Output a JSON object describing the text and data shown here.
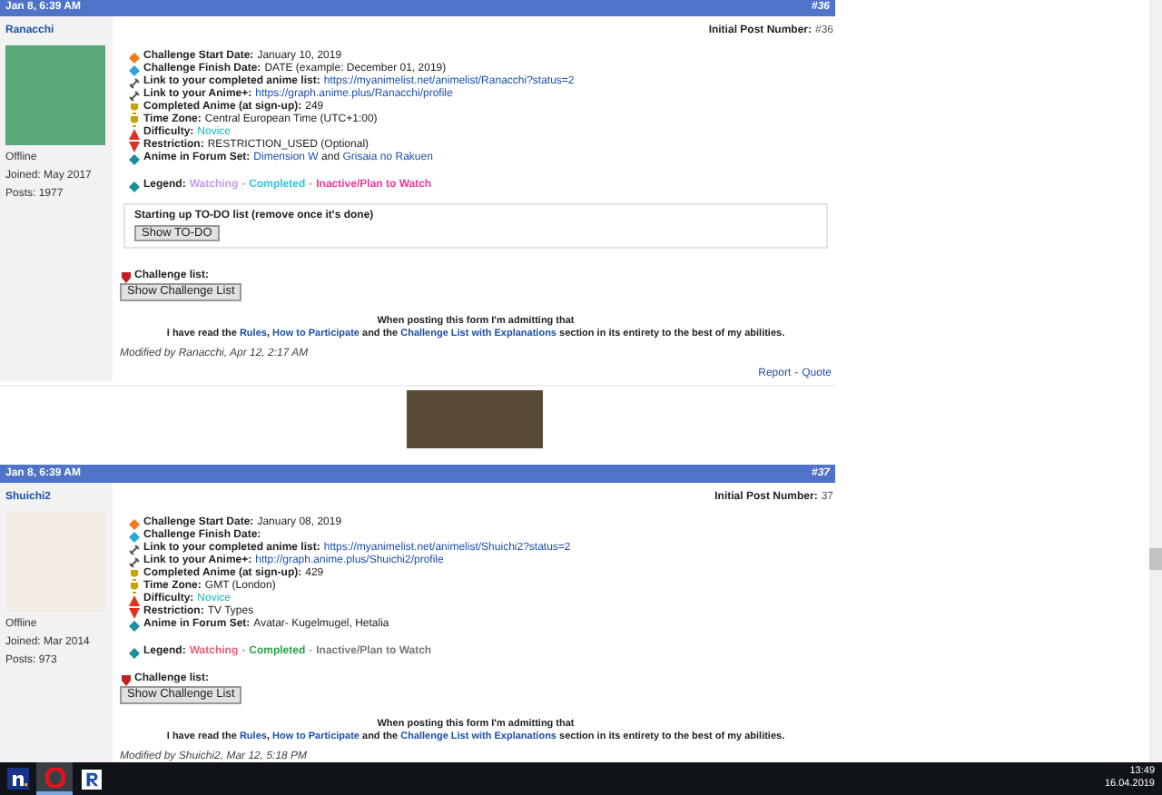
{
  "posts": [
    {
      "date": "Jan 8, 6:39 AM",
      "number": "#36",
      "username": "Ranacchi",
      "status": "Offline",
      "joined": "Joined: May 2017",
      "post_count": "Posts: 1977",
      "initial_label": "Initial Post Number:",
      "initial_value": "#36",
      "fields": [
        {
          "label": "Challenge Start Date:",
          "parts": [
            {
              "text": "January 10, 2019",
              "link": false
            }
          ]
        },
        {
          "label": "Challenge Finish Date:",
          "parts": [
            {
              "text": "DATE (example: December 01, 2019)",
              "link": false
            }
          ]
        },
        {
          "label": "Link to your completed anime list:",
          "parts": [
            {
              "text": "https://myanimelist.net/animelist/Ranacchi?status=2",
              "link": true
            }
          ]
        },
        {
          "label": "Link to your Anime+:",
          "parts": [
            {
              "text": "https://graph.anime.plus/Ranacchi/profile",
              "link": true
            }
          ]
        },
        {
          "label": "Completed Anime (at sign-up):",
          "parts": [
            {
              "text": "249",
              "link": false
            }
          ]
        },
        {
          "label": "Time Zone:",
          "parts": [
            {
              "text": "Central European Time (UTC+1:00)",
              "link": false
            }
          ]
        },
        {
          "label": "Difficulty:",
          "parts": [
            {
              "text": "Novice",
              "link": false,
              "color": "#19b5c4"
            }
          ]
        },
        {
          "label": "Restriction:",
          "parts": [
            {
              "text": "RESTRICTION_USED (Optional)",
              "link": false
            }
          ]
        },
        {
          "label": "Anime in Forum Set:",
          "parts": [
            {
              "text": "Dimension W",
              "link": true
            },
            {
              "text": "and",
              "link": false
            },
            {
              "text": "Grisaia no Rakuen",
              "link": true
            }
          ]
        }
      ],
      "legend_label": "Legend:",
      "legend_separator": "-",
      "legend": [
        {
          "text": "Watching",
          "color": "#c49be8"
        },
        {
          "text": "Completed",
          "color": "#2fc7e0"
        },
        {
          "text": "Inactive/Plan to Watch",
          "color": "#f0389a"
        }
      ],
      "todo": {
        "title": "Starting up TO-DO list (remove once it's done)",
        "button": "Show TO-DO"
      },
      "challenge_label": "Challenge list:",
      "challenge_button": "Show Challenge List",
      "notice_1": "When posting this form I'm admitting that",
      "notice_2": [
        {
          "text": "I have read the",
          "link": false
        },
        {
          "text": "Rules",
          "link": true
        },
        {
          "text": ",",
          "link": false
        },
        {
          "text": "How to Participate",
          "link": true
        },
        {
          "text": "and the",
          "link": false
        },
        {
          "text": "Challenge List with Explanations",
          "link": true
        },
        {
          "text": "section in its entirety to the best of my abilities.",
          "link": false
        }
      ],
      "modified": "Modified by Ranacchi, Apr 12, 2:17 AM",
      "action_separator": "-",
      "actions": [
        {
          "text": "Report"
        },
        {
          "text": "Quote"
        }
      ],
      "signature": {
        "kind": "image"
      }
    },
    {
      "date": "Jan 8, 6:39 AM",
      "number": "#37",
      "username": "Shuichi2",
      "status": "Offline",
      "joined": "Joined: Mar 2014",
      "post_count": "Posts: 973",
      "initial_label": "Initial Post Number:",
      "initial_value": "37",
      "fields": [
        {
          "label": "Challenge Start Date:",
          "parts": [
            {
              "text": "January 08, 2019",
              "link": false
            }
          ]
        },
        {
          "label": "Challenge Finish Date:"
        },
        {
          "label": "Link to your completed anime list:",
          "parts": [
            {
              "text": "https://myanimelist.net/animelist/Shuichi2?status=2",
              "link": true
            }
          ]
        },
        {
          "label": "Link to your Anime+:",
          "parts": [
            {
              "text": "http://graph.anime.plus/Shuichi2/profile",
              "link": true
            }
          ]
        },
        {
          "label": "Completed Anime (at sign-up):",
          "parts": [
            {
              "text": "429",
              "link": false
            }
          ]
        },
        {
          "label": "Time Zone:",
          "parts": [
            {
              "text": "GMT (London)",
              "link": false
            }
          ]
        },
        {
          "label": "Difficulty:",
          "parts": [
            {
              "text": "Novice",
              "link": false,
              "color": "#19b5c4"
            }
          ]
        },
        {
          "label": "Restriction:",
          "parts": [
            {
              "text": "TV Types",
              "link": false
            }
          ]
        },
        {
          "label": "Anime in Forum Set:",
          "parts": [
            {
              "text": "Avatar- Kugelmugel, Hetalia",
              "link": false
            }
          ]
        }
      ],
      "legend_label": "Legend:",
      "legend_separator": "-",
      "legend": [
        {
          "text": "Watching",
          "color": "#e8607a"
        },
        {
          "text": "Completed",
          "color": "#2aa34a"
        },
        {
          "text": "Inactive/Plan to Watch",
          "color": "#777777"
        }
      ],
      "challenge_label": "Challenge list:",
      "challenge_button": "Show Challenge List",
      "notice_1": "When posting this form I'm admitting that",
      "notice_2": [
        {
          "text": "I have read the",
          "link": false
        },
        {
          "text": "Rules",
          "link": true
        },
        {
          "text": ",",
          "link": false
        },
        {
          "text": "How to Participate",
          "link": true
        },
        {
          "text": "and the",
          "link": false
        },
        {
          "text": "Challenge List with Explanations",
          "link": true
        },
        {
          "text": "section in its entirety to the best of my abilities.",
          "link": false
        }
      ],
      "modified": "Modified by Shuichi2, Mar 12, 5:18 PM"
    }
  ],
  "taskbar": {
    "apps": [
      {
        "kind": "n",
        "selected": false
      },
      {
        "kind": "opera",
        "selected": true
      },
      {
        "kind": "r",
        "selected": false
      }
    ],
    "time": "13:49",
    "date": "16.04.2019"
  }
}
